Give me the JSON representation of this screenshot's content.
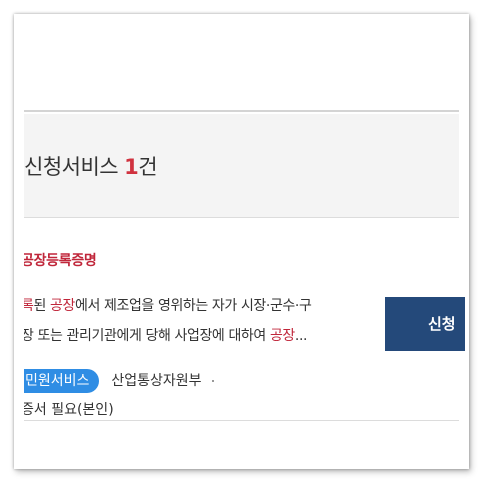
{
  "header": {
    "title": "신청서비스",
    "count": "1",
    "count_unit": "건"
  },
  "result": {
    "service_name": "공장등록증명",
    "desc_line1": [
      {
        "text": "록",
        "hl": true
      },
      {
        "text": "된 ",
        "hl": false
      },
      {
        "text": "공장",
        "hl": true
      },
      {
        "text": "에서 제조업을 영위하는 자가 시장·군수·구",
        "hl": false
      }
    ],
    "desc_line2": [
      {
        "text": "장 또는 관리기관에게 당해 사업장에 대하여 ",
        "hl": false
      },
      {
        "text": "공장",
        "hl": true
      },
      {
        "text": "...",
        "hl": false
      }
    ],
    "category_badge": "민원서비스",
    "agency": "산업통상자원부",
    "requirement": "증서 필요(본인)",
    "apply_label": "신청"
  },
  "colors": {
    "highlight": "#c0263a",
    "count": "#d0323f",
    "badge": "#2f8de4",
    "apply_button": "#24497a",
    "header_band": "#f4f4f4"
  }
}
